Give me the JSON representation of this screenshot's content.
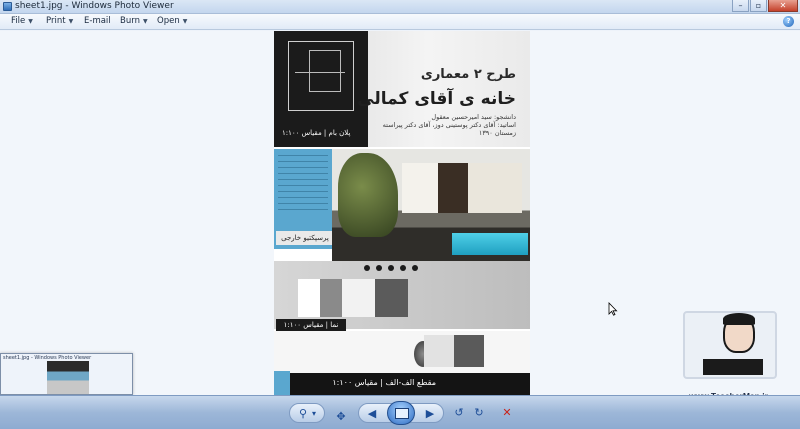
{
  "window": {
    "title": "sheet1.jpg - Windows Photo Viewer",
    "controls": [
      "–",
      "▫",
      "✕"
    ]
  },
  "menu": {
    "items": [
      {
        "label": "File"
      },
      {
        "label": "Print"
      },
      {
        "label": "E-mail"
      },
      {
        "label": "Burn"
      },
      {
        "label": "Open"
      }
    ],
    "help_glyph": "?"
  },
  "sheet": {
    "title_line1": "طرح ۲ معماری",
    "title_line2": "خانه ی آقای کمالی",
    "subtitle": "دانشجو: سید امیرحسین معقول\nاساتید: آقای دکتر پوستینی دوز، آقای دکتر پیراسته\nزمستان ۱۳۹۰",
    "plan_label": "پلان بام | مقیاس ۱:۱۰۰",
    "perspective_label": "پرسپکتیو خارجی",
    "elevation_label": "نما | مقیاس ۱:۱۰۰",
    "section_label": "مقطع الف-الف | مقیاس ۱:۱۰۰"
  },
  "thumbnail": {
    "title": "sheet1.jpg - Windows Photo Viewer"
  },
  "watermark": {
    "url": "www.TeacherMan.ir"
  },
  "toolbar": {
    "zoom_icon": "⚲",
    "zoom_caret": "▾",
    "actual_size_icon": "✥",
    "prev_icon": "◀",
    "next_icon": "▶",
    "rotate_ccw_icon": "↺",
    "rotate_cw_icon": "↻",
    "delete_icon": "✕"
  },
  "colors": {
    "accent": "#2e6bc2",
    "sheet_blue": "#5aa7cf",
    "delete_red": "#c8231a"
  }
}
